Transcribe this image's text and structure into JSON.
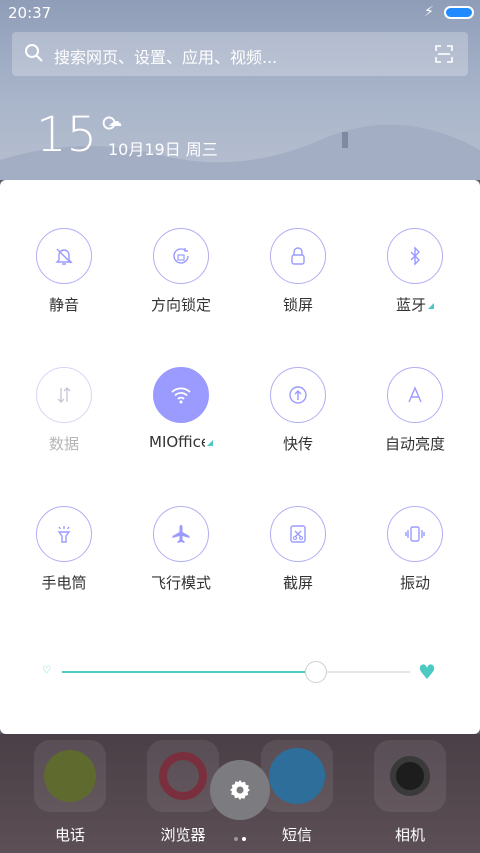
{
  "status": {
    "time": "20:37"
  },
  "search": {
    "placeholder": "搜索网页、设置、应用、视频..."
  },
  "weather": {
    "temperature": "15°",
    "date": "10月19日 周三"
  },
  "toggles": [
    {
      "label": "静音",
      "icon": "mute-bell-icon",
      "active": false
    },
    {
      "label": "方向锁定",
      "icon": "rotation-lock-icon",
      "active": false
    },
    {
      "label": "锁屏",
      "icon": "lock-icon",
      "active": false
    },
    {
      "label": "蓝牙",
      "icon": "bluetooth-icon",
      "active": false
    },
    {
      "label": "数据",
      "icon": "data-arrows-icon",
      "active": false,
      "disabled": true
    },
    {
      "label": "MIOffice",
      "icon": "wifi-icon",
      "active": true
    },
    {
      "label": "快传",
      "icon": "upload-icon",
      "active": false
    },
    {
      "label": "自动亮度",
      "icon": "auto-brightness-icon",
      "active": false
    },
    {
      "label": "手电筒",
      "icon": "flashlight-icon",
      "active": false
    },
    {
      "label": "飞行模式",
      "icon": "airplane-icon",
      "active": false
    },
    {
      "label": "截屏",
      "icon": "screenshot-icon",
      "active": false
    },
    {
      "label": "振动",
      "icon": "vibrate-icon",
      "active": false
    }
  ],
  "brightness": {
    "level": 0.73,
    "color": "#4cc9c2"
  },
  "dock": {
    "apps": [
      "电话",
      "浏览器",
      "短信",
      "相机"
    ]
  },
  "colors": {
    "accent": "#9b9bff",
    "teal": "#4cc9c2"
  }
}
